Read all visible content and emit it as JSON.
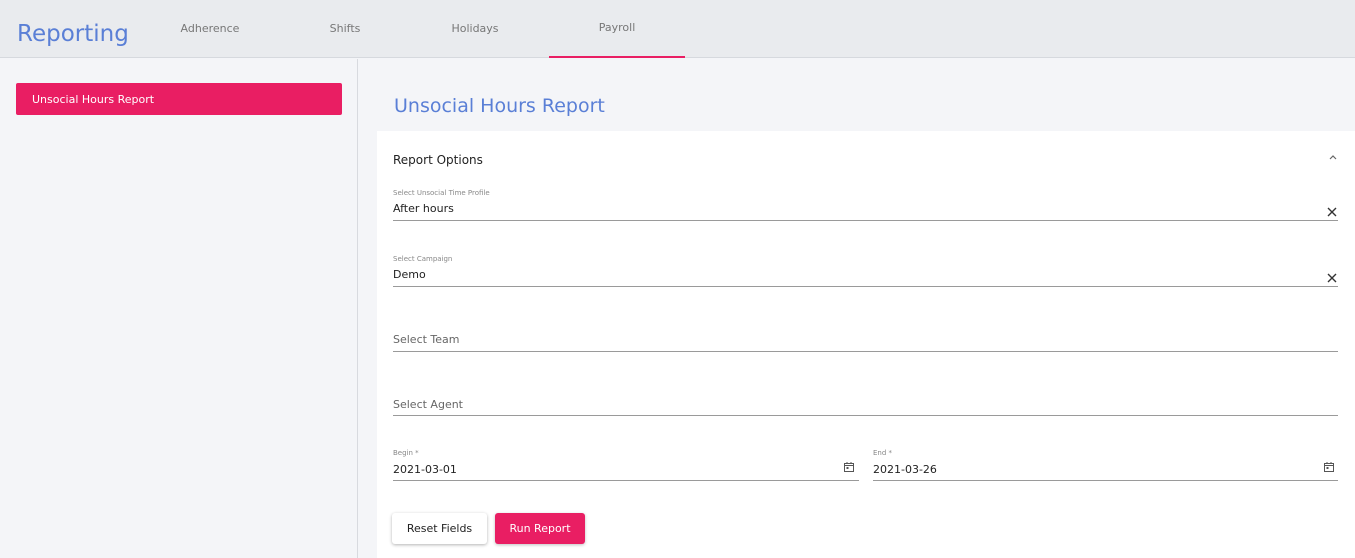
{
  "app": {
    "title": "Reporting"
  },
  "nav": {
    "tabs": [
      {
        "label": "Adherence",
        "active": false
      },
      {
        "label": "Shifts",
        "active": false
      },
      {
        "label": "Holidays",
        "active": false
      },
      {
        "label": "Payroll",
        "active": true
      }
    ]
  },
  "sidebar": {
    "items": [
      {
        "label": "Unsocial Hours Report",
        "selected": true
      }
    ]
  },
  "main": {
    "title": "Unsocial Hours Report",
    "section": {
      "title": "Report Options",
      "collapse_icon": "chevron-up-icon"
    },
    "fields": {
      "profile": {
        "label": "Select Unsocial Time Profile",
        "value": "After hours",
        "clear_icon": "close-icon"
      },
      "campaign": {
        "label": "Select Campaign",
        "value": "Demo",
        "clear_icon": "close-icon"
      },
      "team": {
        "placeholder": "Select Team"
      },
      "agent": {
        "placeholder": "Select Agent"
      },
      "begin": {
        "label": "Begin *",
        "value": "2021-03-01",
        "icon": "calendar-icon"
      },
      "end": {
        "label": "End *",
        "value": "2021-03-26",
        "icon": "calendar-icon"
      }
    },
    "buttons": {
      "reset_label": "Reset Fields",
      "run_label": "Run Report"
    }
  },
  "colors": {
    "accent": "#e91e63",
    "brand_blue": "#5a7fd6",
    "topbar_bg": "#e9ebee"
  }
}
